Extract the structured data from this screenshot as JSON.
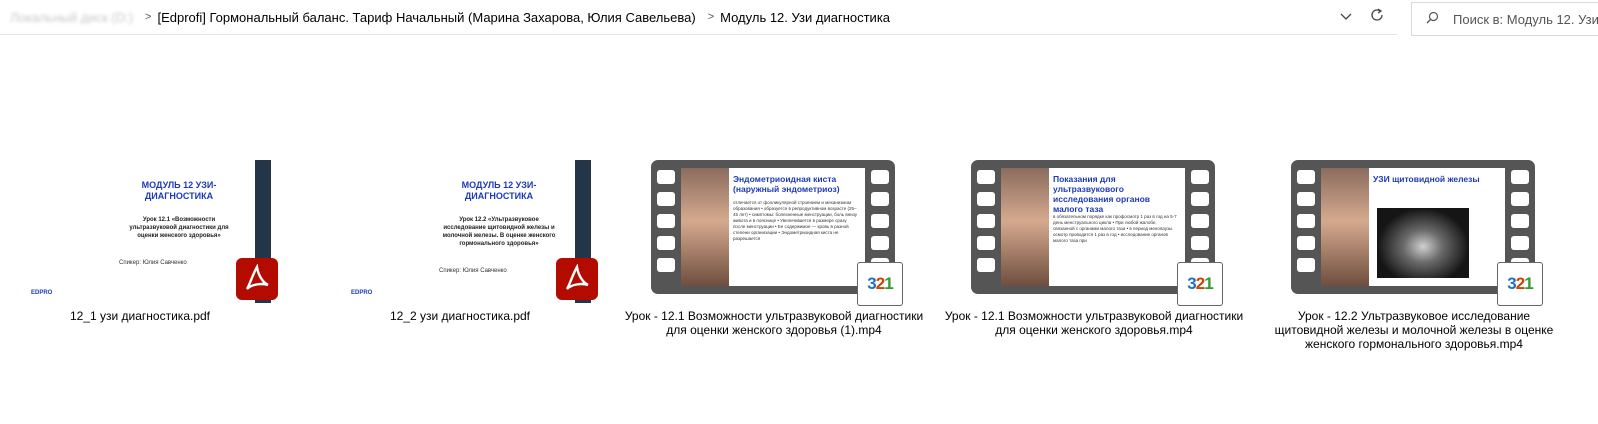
{
  "address_bar": {
    "root_blurred": "Локальный диск (D:)",
    "crumb_1": "[Edprofi] Гормональный баланс. Тариф Начальный (Марина Захарова, Юлия Савельева)",
    "crumb_2": "Модуль 12. Узи диагностика",
    "separator": ">"
  },
  "search": {
    "placeholder": "Поиск в: Модуль 12. Узи",
    "icon": "search-icon"
  },
  "files": [
    {
      "name": "12_1 узи диагностика.pdf",
      "type": "pdf",
      "thumb": {
        "title": "МОДУЛЬ 12 УЗИ-\nДИАГНОСТИКА",
        "lesson": "Урок 12.1 «Возможности ультразвуковой диагностики для оценки женского здоровья»",
        "speaker": "Спикер: Юлия Савченко",
        "brand": "EDPRO"
      }
    },
    {
      "name": "12_2 узи диагностика.pdf",
      "type": "pdf",
      "thumb": {
        "title": "МОДУЛЬ 12 УЗИ-\nДИАГНОСТИКА",
        "lesson": "Урок 12.2 «Ультразвуковое исследование щитовидной железы и молочной железы. В оценке женского гормонального здоровья»",
        "speaker": "Спикер: Юлия Савченко",
        "brand": "EDPRO"
      }
    },
    {
      "name": "Урок - 12.1 Возможности ультразвуковой диагностики для оценки женского здоровья (1).mp4",
      "type": "mp4",
      "thumb": {
        "slide_title": "Эндометриоидная киста (наружный эндометриоз)",
        "slide_text": "отличается от фолликулярной строением и механизмом образования • образуется в репродуктивном возрасте (25–45 лет) • симптомы: болезненные менструации, боль внизу живота и в пояснице • Увеличивается в размере сразу после менструации • Ее содержимое — кровь в разной степени организации • Эндометриоидная киста не разрешается",
        "badge": "321"
      }
    },
    {
      "name": "Урок - 12.1 Возможности ультразвуковой диагностики для оценки женского здоровья.mp4",
      "type": "mp4",
      "thumb": {
        "slide_title": "Показания для ультразвукового исследования органов малого таза",
        "slide_text": "в обязательном порядке как профосмотр 1 раз в год на 5-7 день менструального цикла • При любой жалобе, связанной с органами малого таза • в период менопаузы осмотр проводится 1 раз в год • исследование органов малого таза при",
        "badge": "321"
      }
    },
    {
      "name": "Урок - 12.2 Ультразвуковое исследование щитовидной железы и молочной железы в оценке женского гормонального здоровья.mp4",
      "type": "mp4",
      "thumb": {
        "slide_title": "УЗИ щитовидной железы",
        "slide_text": "",
        "badge": "321"
      }
    }
  ],
  "colors": {
    "accent_blue": "#1e39b8",
    "pdf_red": "#b30b00",
    "film_gray": "#555555"
  }
}
